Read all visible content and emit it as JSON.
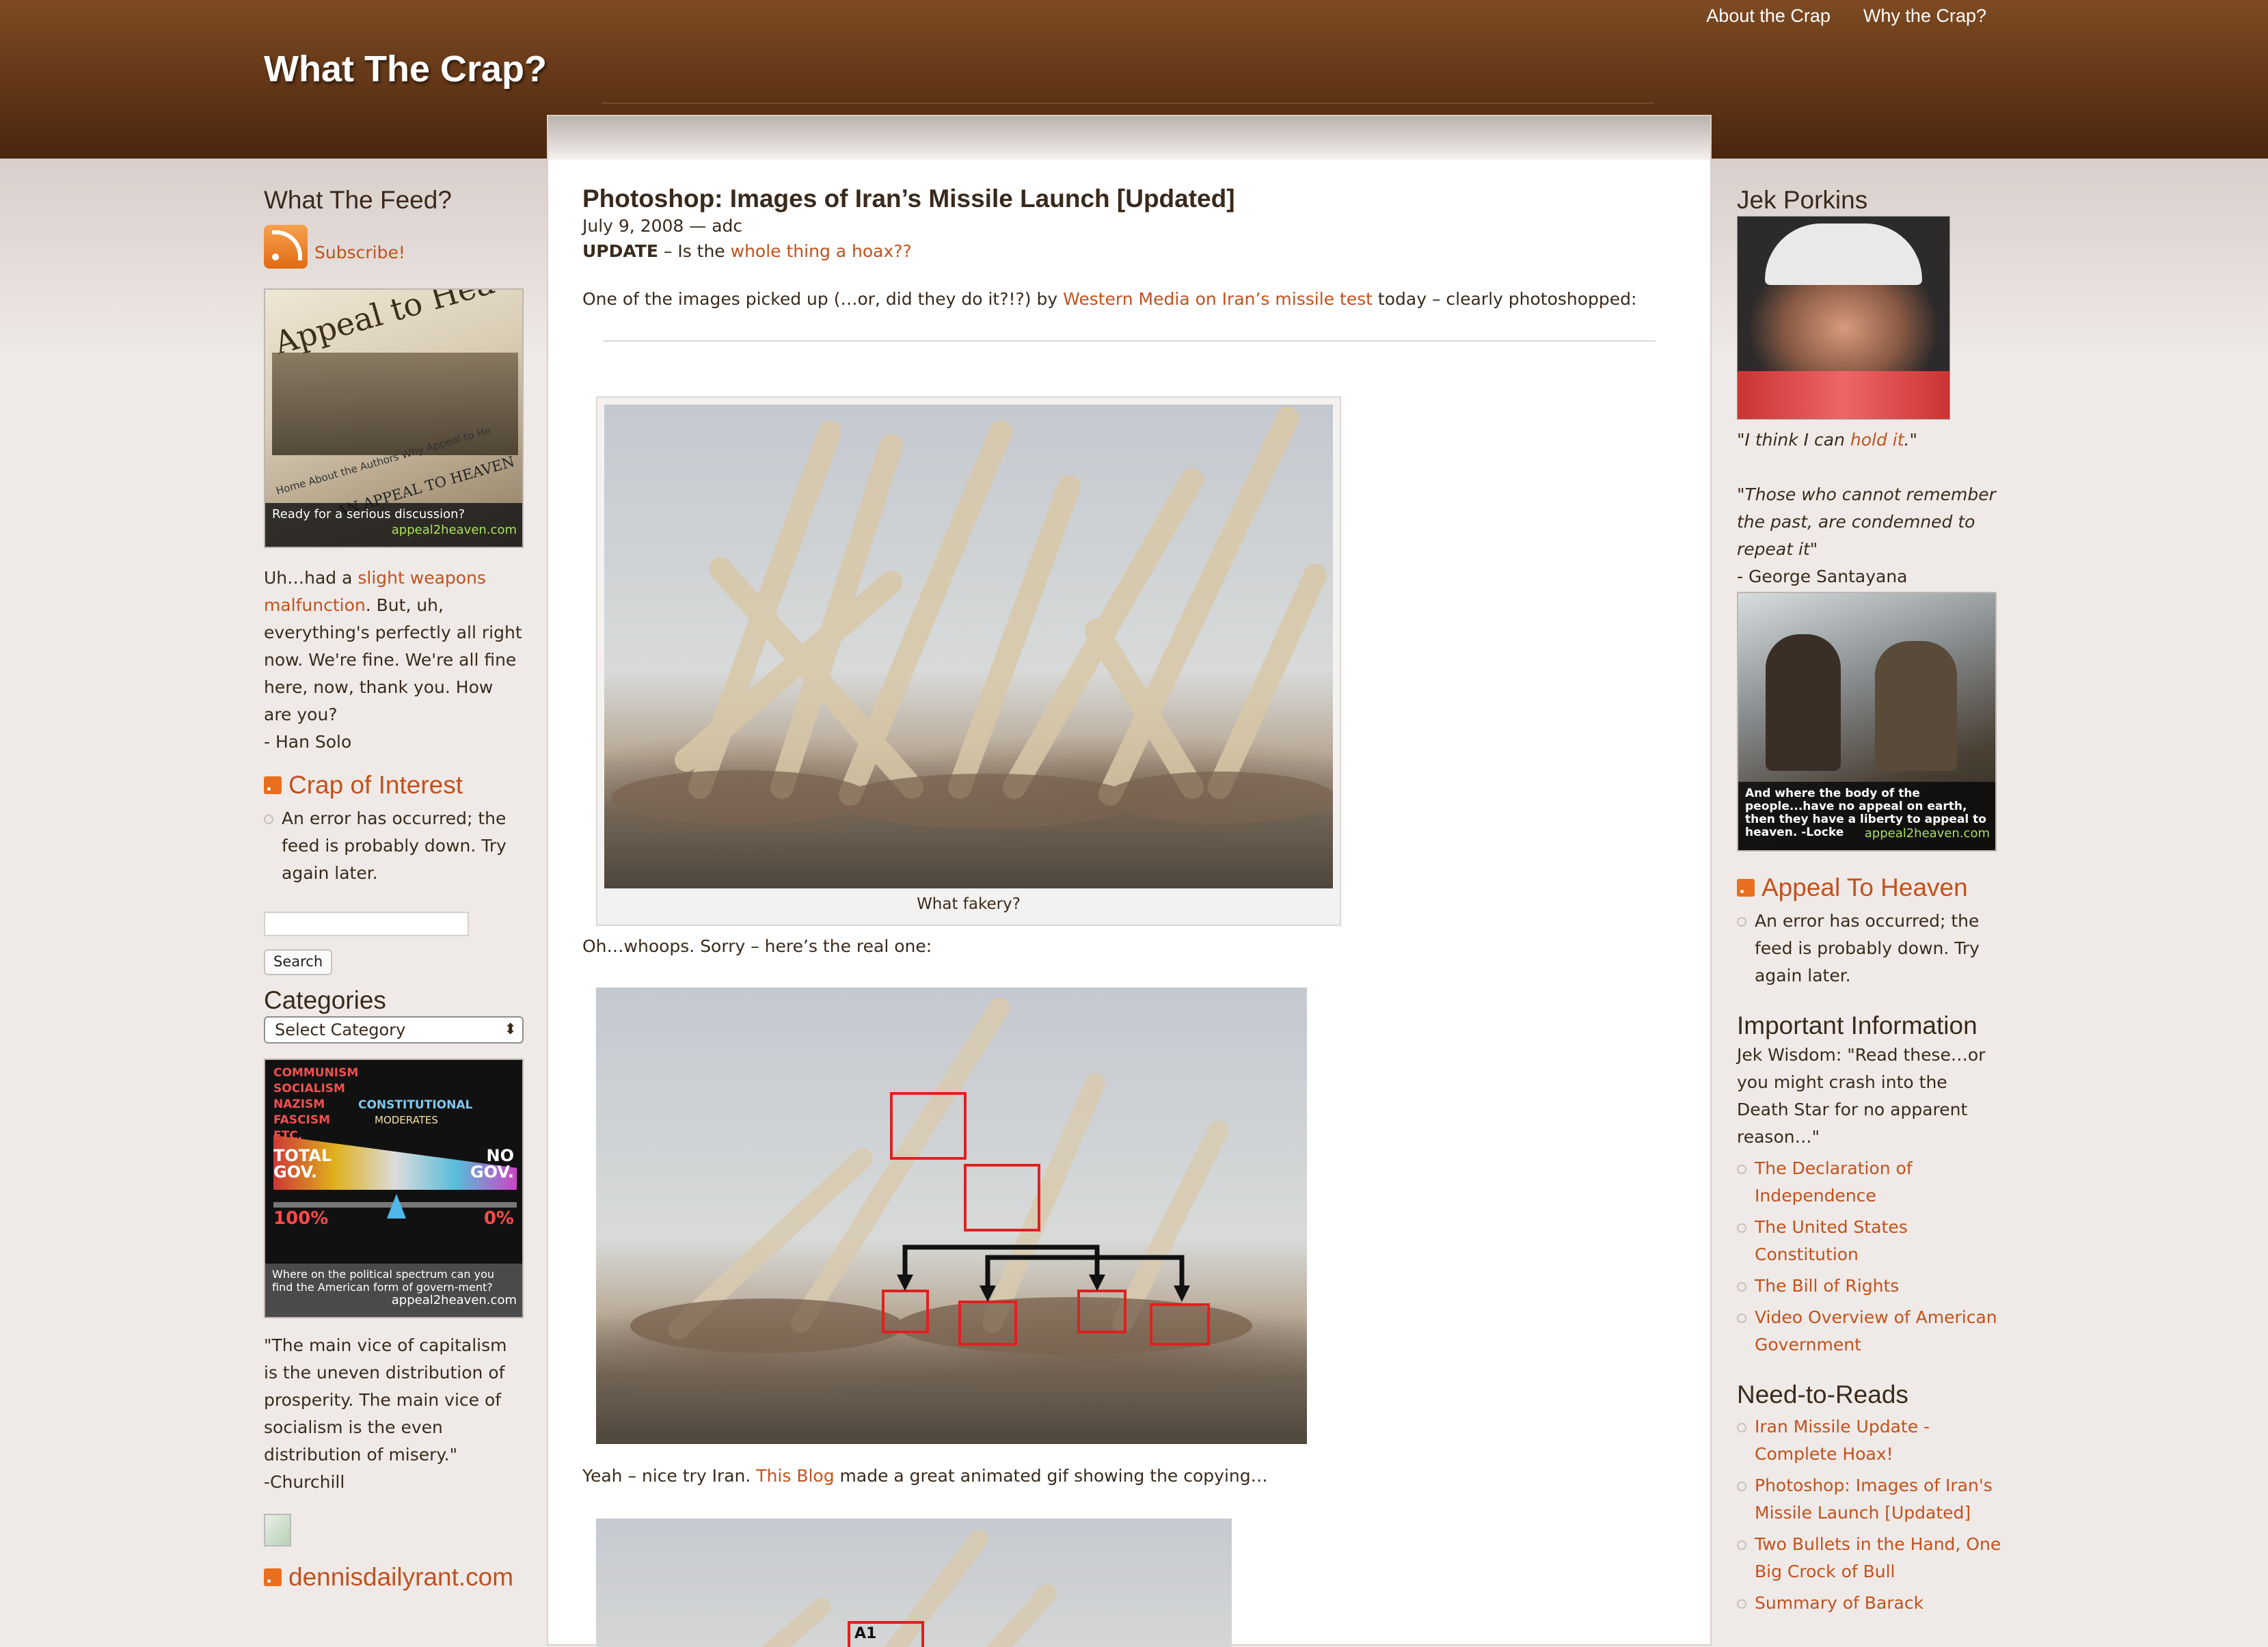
{
  "site": {
    "title": "What The Crap?"
  },
  "nav": {
    "about": "About the Crap",
    "why": "Why the Crap?"
  },
  "post": {
    "title": "Photoshop: Images of Iran’s Missile Launch [Updated]",
    "meta": "July 9, 2008 — adc",
    "update_label": "UPDATE",
    "update_prefix": " – Is the ",
    "update_link": "whole thing a hoax??",
    "p1_prefix": "One of the images picked up (…or, did they do it?!?) by ",
    "p1_link": "Western Media on Iran’s missile test",
    "p1_suffix": " today – clearly photoshopped:",
    "caption1": "What fakery?",
    "p2": "Oh…whoops. Sorry – here’s the real one:",
    "p3_prefix": "Yeah – nice try Iran. ",
    "p3_link": "This Blog",
    "p3_suffix": " made a great animated gif showing the copying…",
    "image3_label": "A1"
  },
  "left_sidebar": {
    "feed_title": "What The Feed?",
    "subscribe": "Subscribe!",
    "banner1": {
      "headline": "Appeal to Heav",
      "nav": "Home   About the Authors   Why Appeal to He",
      "sub": "AN APPEAL TO HEAVEN",
      "caption": "Ready for a serious discussion?",
      "url": "appeal2heaven.com"
    },
    "quote1_prefix": "Uh…had a ",
    "quote1_link": "slight weapons malfunction",
    "quote1_suffix": ". But, uh, everything's perfectly all right now. We're fine. We're all fine here, now, thank you. How are you?",
    "quote1_author": "- Han Solo",
    "crap_title": "Crap of Interest",
    "crap_error": "An error has occurred; the feed is probably down. Try again later.",
    "search_button": "Search",
    "categories_title": "Categories",
    "categories_select": "Select Category",
    "spectrum": {
      "isms": "COMMUNISM\nSOCIALISM\nNAZISM\nFASCISM\nETC.",
      "constitutional": "CONSTITUTIONAL",
      "moderates": "MODERATES",
      "total": "TOTAL\nGOV.",
      "no": "NO\nGOV.",
      "left_pct": "100%",
      "right_pct": "0%",
      "caption": "Where on the political spectrum can you find the American form of govern-ment?",
      "url": "appeal2heaven.com"
    },
    "quote2": "\"The main vice of capitalism is the uneven distribution of prosperity. The main vice of socialism is the even distribution of misery.\"",
    "quote2_author": "-Churchill",
    "dennis_title": "dennisdailyrant.com"
  },
  "right_sidebar": {
    "jek_title": "Jek Porkins",
    "jek_quote_prefix": "\"I think I can ",
    "jek_quote_link": "hold it",
    "jek_quote_suffix": ".\"",
    "santayana": "\"Those who cannot remember the past, are condemned to repeat it\"",
    "santayana_author": "- George Santayana",
    "locke_caption": "And where the body of the people...have no appeal on earth, then they have a liberty to appeal to heaven.  -Locke",
    "locke_url": "appeal2heaven.com",
    "appeal_title": "Appeal To Heaven",
    "appeal_error": "An error has occurred; the feed is probably down. Try again later.",
    "info_title": "Important Information",
    "info_text": "Jek Wisdom: \"Read these…or you might crash into the Death Star for no apparent reason…\"",
    "info_links": [
      "The Declaration of Independence",
      "The United States Constitution",
      "The Bill of Rights",
      "Video Overview of American Government"
    ],
    "need_title": "Need-to-Reads",
    "need_links": [
      "Iran Missile Update - Complete Hoax!",
      "Photoshop: Images of Iran's Missile Launch [Updated]",
      "Two Bullets in the Hand, One Big Crock of Bull",
      "Summary of Barack"
    ]
  },
  "colors": {
    "link": "#c2511d",
    "header": "#5f3416",
    "text": "#3a2a1c"
  }
}
